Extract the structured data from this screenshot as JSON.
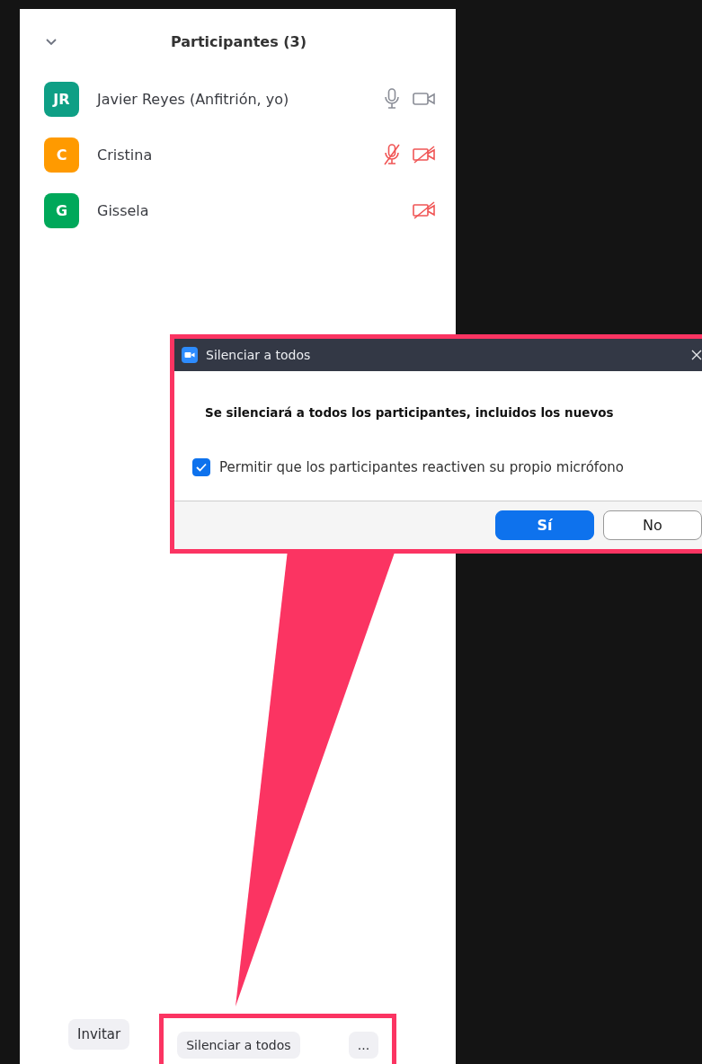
{
  "panel": {
    "title": "Participantes (3)"
  },
  "participants": [
    {
      "initials": "JR",
      "color": "#0e9f85",
      "name": "Javier Reyes (Anfitrión, yo)",
      "has_audio": true,
      "mic_muted": false,
      "video_off": false
    },
    {
      "initials": "C",
      "color": "#ff9a00",
      "name": "Cristina",
      "has_audio": true,
      "mic_muted": true,
      "video_off": true
    },
    {
      "initials": "G",
      "color": "#00a85a",
      "name": "Gissela",
      "has_audio": false,
      "video_off": true
    }
  ],
  "footer_buttons": [
    {
      "label": "Invitar",
      "highlighted": false
    },
    {
      "label": "Silenciar a todos",
      "highlighted": true
    },
    {
      "label": "...",
      "highlighted": true
    }
  ],
  "dialog": {
    "title": "Silenciar a todos",
    "message": "Se silenciará a todos los participantes, incluidos los nuevos",
    "checkbox": {
      "label": "Permitir que los participantes reactiven su propio micrófono",
      "checked": true
    },
    "buttons": [
      {
        "label": "Sí",
        "kind": "primary"
      },
      {
        "label": "No",
        "kind": "secondary"
      }
    ]
  }
}
